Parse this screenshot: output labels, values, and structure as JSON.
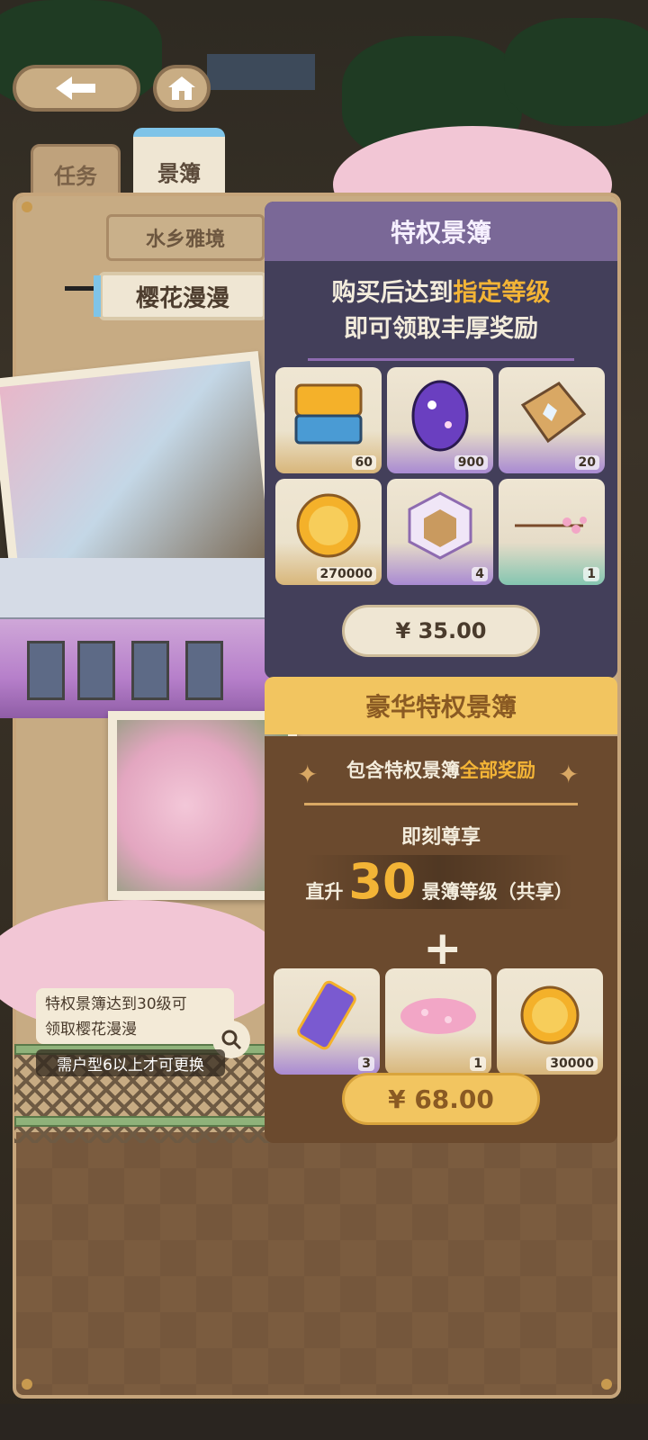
{
  "tabs": {
    "task": "任务",
    "scenebook": "景簿"
  },
  "board": {
    "place": "水乡雅境",
    "scene": "樱花漫漫"
  },
  "notice": {
    "line1": "特权景簿达到30级可",
    "line2": "领取樱花漫漫",
    "requirement": "需户型6以上才可更换"
  },
  "privilege": {
    "title": "特权景簿",
    "desc_prefix": "购买后达到",
    "desc_highlight": "指定等级",
    "desc_line2": "即可领取丰厚奖励",
    "items": [
      {
        "icon": "gold-ticket-box-icon",
        "count": "60"
      },
      {
        "icon": "galaxy-egg-icon",
        "count": "900"
      },
      {
        "icon": "crystal-book-icon",
        "count": "20"
      },
      {
        "icon": "gold-coin-icon",
        "count": "270000"
      },
      {
        "icon": "hexagon-room-icon",
        "count": "4"
      },
      {
        "icon": "blossom-branch-icon",
        "count": "1"
      }
    ],
    "price": "¥ 35.00"
  },
  "deluxe": {
    "title": "豪华特权景簿",
    "include_prefix": "包含特权景簿",
    "include_highlight": "全部奖励",
    "enjoy": "即刻尊享",
    "level_prefix": "直升",
    "level_num": "30",
    "level_suffix": "景簿等级（共享）",
    "plus": "+",
    "items": [
      {
        "icon": "purple-card-icon",
        "count": "3"
      },
      {
        "icon": "pink-blossom-patch-icon",
        "count": "1"
      },
      {
        "icon": "gold-coin-icon",
        "count": "30000"
      }
    ],
    "price": "¥ 68.00"
  }
}
